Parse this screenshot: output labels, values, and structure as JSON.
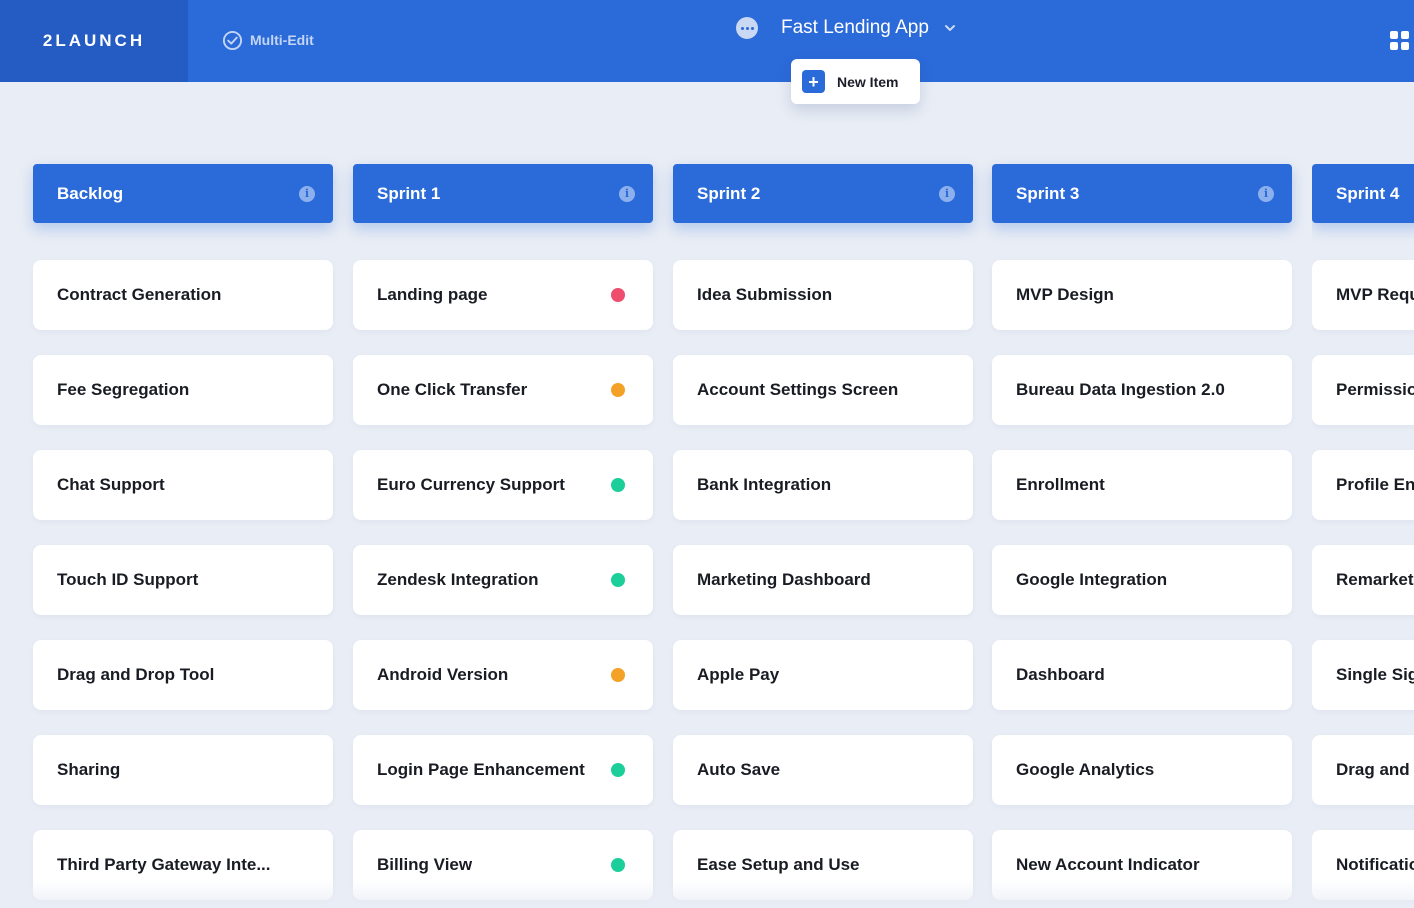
{
  "brand": {
    "logo_text": "2LAUNCH"
  },
  "toolbar": {
    "multi_edit_label": "Multi-Edit",
    "app_title": "Fast Lending App",
    "new_item_label": "New Item"
  },
  "colors": {
    "primary": "#2b6ad9",
    "red": "#ee4d6e",
    "orange": "#f3a127",
    "green": "#1ccf9a"
  },
  "columns": [
    {
      "title": "Backlog",
      "cards": [
        {
          "title": "Contract Generation"
        },
        {
          "title": "Fee Segregation"
        },
        {
          "title": "Chat Support"
        },
        {
          "title": "Touch ID Support"
        },
        {
          "title": "Drag and Drop Tool"
        },
        {
          "title": "Sharing"
        },
        {
          "title": "Third Party Gateway Inte..."
        }
      ]
    },
    {
      "title": "Sprint 1",
      "cards": [
        {
          "title": "Landing page",
          "status": "red"
        },
        {
          "title": "One Click Transfer",
          "status": "orange"
        },
        {
          "title": "Euro Currency Support",
          "status": "green"
        },
        {
          "title": "Zendesk Integration",
          "status": "green"
        },
        {
          "title": "Android Version",
          "status": "orange"
        },
        {
          "title": "Login Page Enhancement",
          "status": "green"
        },
        {
          "title": "Billing View",
          "status": "green"
        }
      ]
    },
    {
      "title": "Sprint 2",
      "cards": [
        {
          "title": "Idea Submission"
        },
        {
          "title": "Account Settings Screen"
        },
        {
          "title": "Bank Integration"
        },
        {
          "title": "Marketing Dashboard"
        },
        {
          "title": "Apple Pay"
        },
        {
          "title": "Auto Save"
        },
        {
          "title": "Ease Setup and Use"
        }
      ]
    },
    {
      "title": "Sprint 3",
      "cards": [
        {
          "title": "MVP Design"
        },
        {
          "title": "Bureau Data Ingestion 2.0"
        },
        {
          "title": "Enrollment"
        },
        {
          "title": "Google Integration"
        },
        {
          "title": "Dashboard"
        },
        {
          "title": "Google Analytics"
        },
        {
          "title": "New Account Indicator"
        }
      ]
    },
    {
      "title": "Sprint 4",
      "cards": [
        {
          "title": "MVP Requ"
        },
        {
          "title": "Permissio"
        },
        {
          "title": "Profile En"
        },
        {
          "title": "Remarketi"
        },
        {
          "title": "Single Sig"
        },
        {
          "title": "Drag and"
        },
        {
          "title": "Notificatio"
        }
      ]
    }
  ]
}
